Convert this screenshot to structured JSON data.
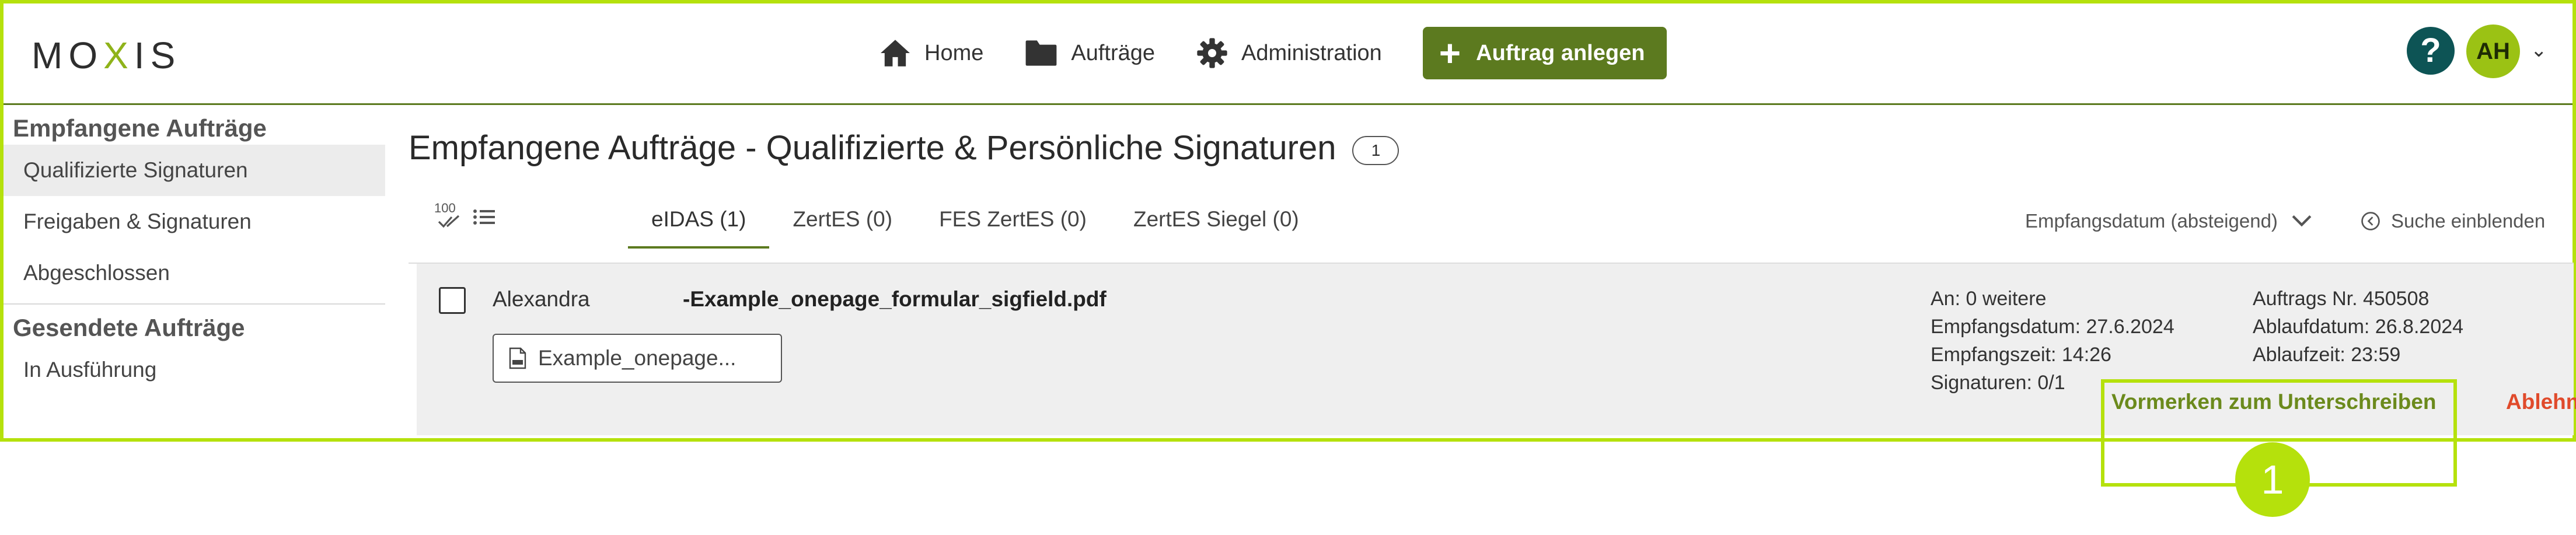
{
  "header": {
    "logo_left": "MO",
    "logo_x": "X",
    "logo_right": "IS",
    "nav": [
      {
        "label": "Home",
        "icon": "home-icon"
      },
      {
        "label": "Aufträge",
        "icon": "folder-icon"
      },
      {
        "label": "Administration",
        "icon": "gear-icon"
      }
    ],
    "new_button_label": "Auftrag anlegen",
    "help_label": "?",
    "avatar_initials": "AH"
  },
  "sidebar": {
    "received_heading": "Empfangene Aufträge",
    "received_items": [
      "Qualifizierte Signaturen",
      "Freigaben & Signaturen",
      "Abgeschlossen"
    ],
    "sent_heading": "Gesendete Aufträge",
    "sent_items": [
      "In Ausführung"
    ]
  },
  "main": {
    "title": "Empfangene Aufträge - Qualifizierte & Persönliche Signaturen",
    "count": "1",
    "view_icon_label": "100",
    "tabs": [
      "eIDAS (1)",
      "ZertES (0)",
      "FES ZertES (0)",
      "ZertES Siegel (0)"
    ],
    "sort_label": "Empfangsdatum (absteigend)",
    "search_toggle_label": "Suche einblenden"
  },
  "order": {
    "sender": "Alexandra",
    "document_name": "-Example_onepage_formular_sigfield.pdf",
    "file_chip": "Example_onepage...",
    "recipients": "An: 0 weitere",
    "received_date": "Empfangsdatum: 27.6.2024",
    "received_time": "Empfangszeit: 14:26",
    "signatures": "Signaturen: 0/1",
    "order_number": "Auftrags Nr. 450508",
    "expiry_date": "Ablaufdatum: 26.8.2024",
    "expiry_time": "Ablaufzeit: 23:59",
    "reserve_label": "Vormerken zum Unterschreiben",
    "reject_label": "Ablehnen"
  },
  "annotation": {
    "marker_number": "1"
  },
  "colors": {
    "accent": "#5c7a1f",
    "highlight": "#b5e10c",
    "reject": "#e04a2b",
    "help": "#0d5455"
  }
}
